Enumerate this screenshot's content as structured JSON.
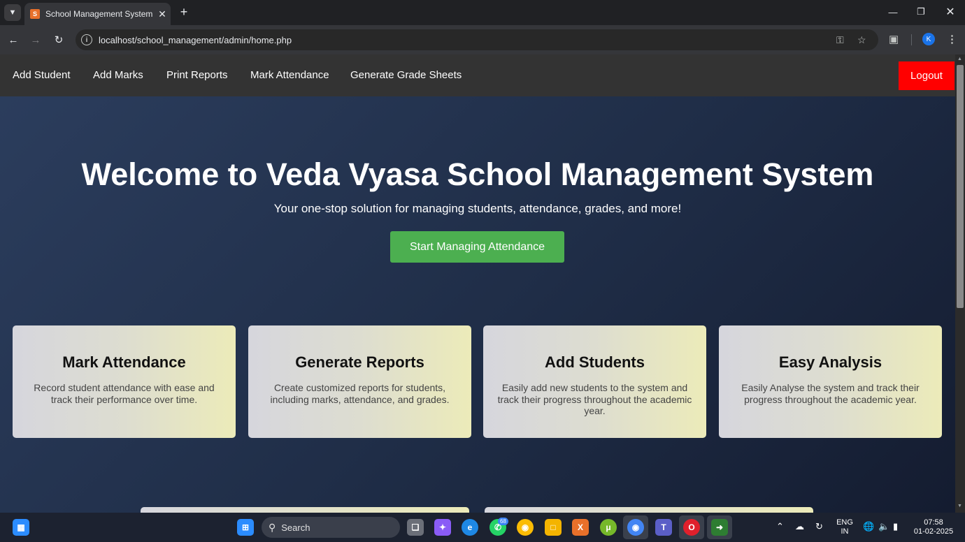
{
  "browser": {
    "tab_title": "School Management System",
    "favicon_letter": "S",
    "url": "localhost/school_management/admin/home.php",
    "profile_initial": "K"
  },
  "nav": {
    "items": [
      "Add Student",
      "Add Marks",
      "Print Reports",
      "Mark Attendance",
      "Generate Grade Sheets"
    ],
    "logout": "Logout"
  },
  "hero": {
    "title": "Welcome to Veda Vyasa School Management System",
    "subtitle": "Your one-stop solution for managing students, attendance, grades, and more!",
    "cta": "Start Managing Attendance"
  },
  "cards": [
    {
      "title": "Mark Attendance",
      "text": "Record student attendance with ease and track their performance over time."
    },
    {
      "title": "Generate Reports",
      "text": "Create customized reports for students, including marks, attendance, and grades."
    },
    {
      "title": "Add Students",
      "text": "Easily add new students to the system and track their progress throughout the academic year."
    },
    {
      "title": "Easy Analysis",
      "text": "Easily Analyse the system and track their progress throughout the academic year."
    }
  ],
  "taskbar": {
    "search_placeholder": "Search",
    "whatsapp_badge": "68",
    "language": "ENG",
    "region": "IN",
    "time": "07:58",
    "date": "01-02-2025"
  },
  "colors": {
    "logout_bg": "#ff0000",
    "cta_bg": "#4caf50",
    "nav_bg": "#333333"
  }
}
